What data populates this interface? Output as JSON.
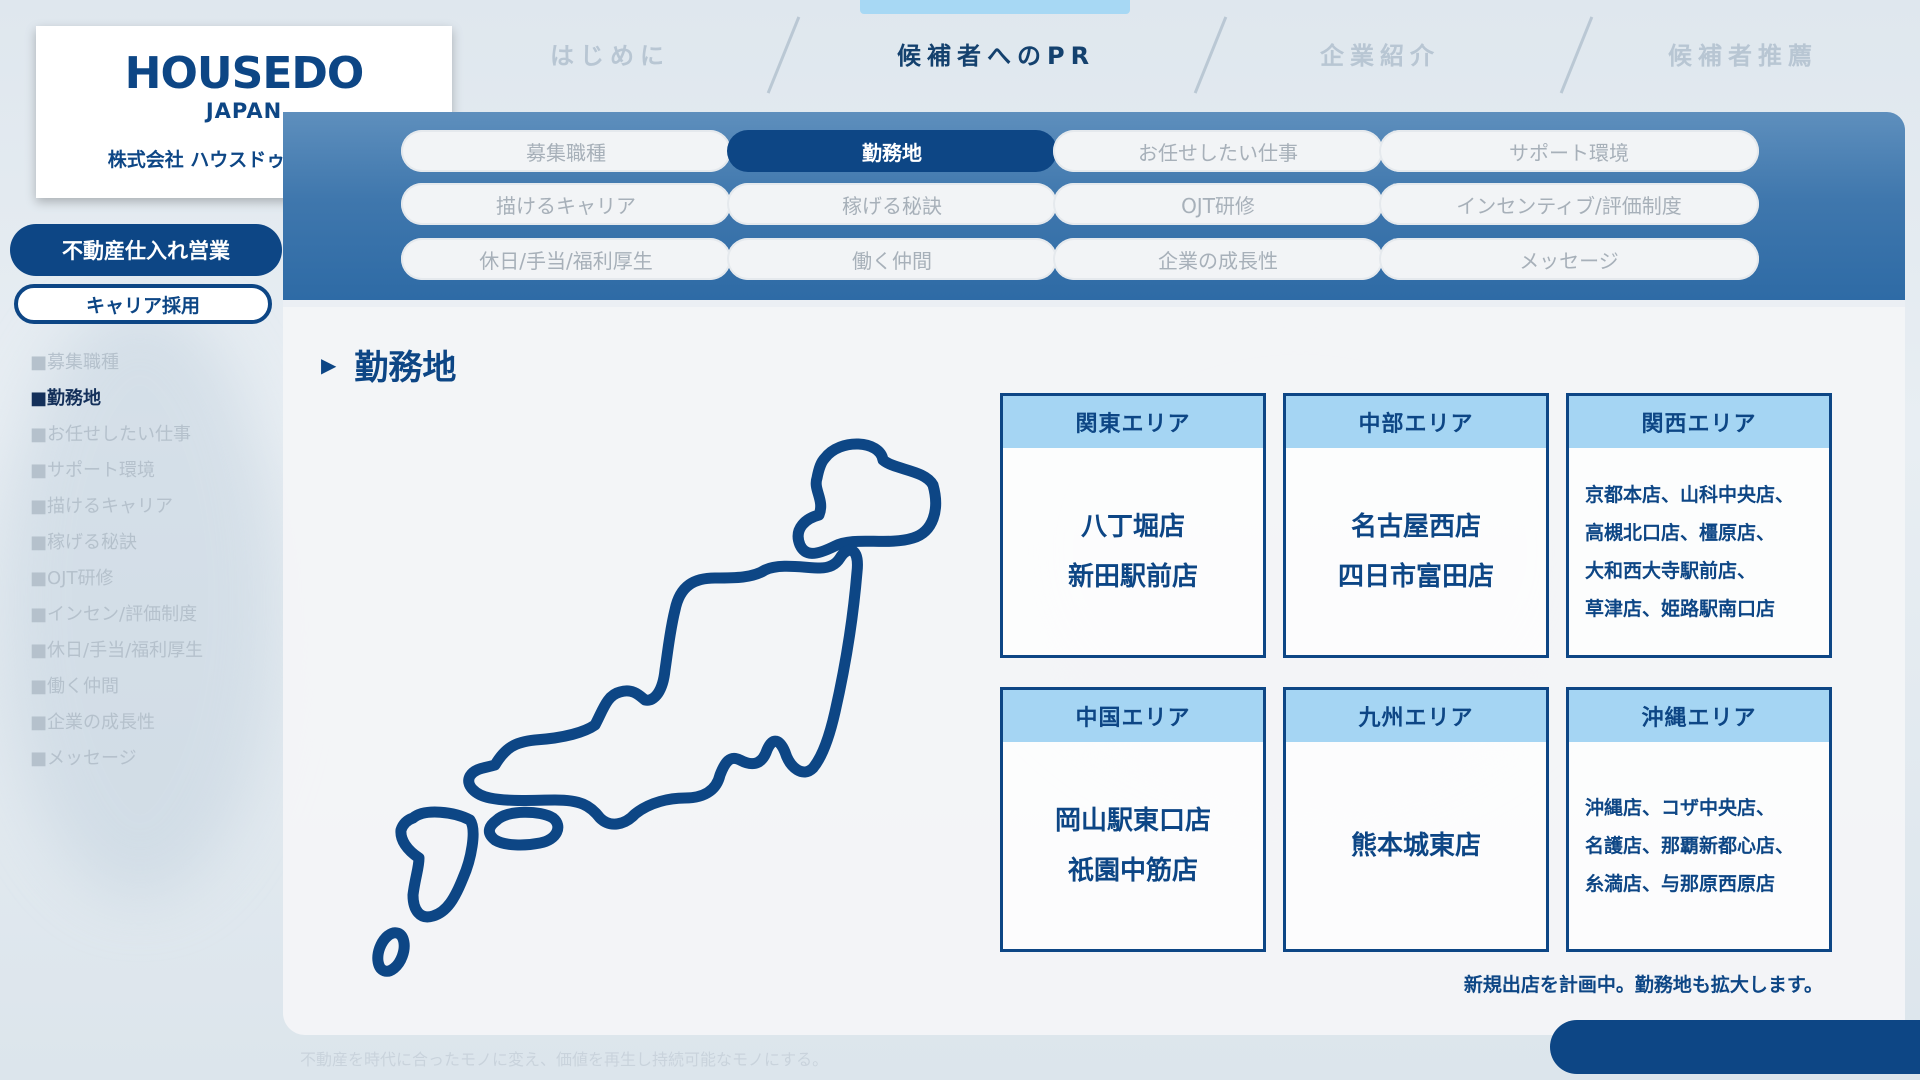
{
  "brand": {
    "logo_main": "HOUSEDO",
    "logo_sub": "JAPAN",
    "company": "株式会社 ハウスドゥ・ジャパン"
  },
  "top_nav": [
    {
      "label": "はじめに",
      "active": false
    },
    {
      "label": "候補者へのPR",
      "active": true
    },
    {
      "label": "企業紹介",
      "active": false
    },
    {
      "label": "候補者推薦",
      "active": false
    }
  ],
  "menu": [
    [
      "募集職種",
      "勤務地",
      "お任せしたい仕事",
      "サポート環境"
    ],
    [
      "描けるキャリア",
      "稼げる秘訣",
      "OJT研修",
      "インセンティブ/評価制度"
    ],
    [
      "休日/手当/福利厚生",
      "働く仲間",
      "企業の成長性",
      "メッセージ"
    ]
  ],
  "menu_active": "勤務地",
  "sidebar": {
    "main_button": "不動産仕入れ営業",
    "sub_button": "キャリア採用",
    "items": [
      "■募集職種",
      "■勤務地",
      "■お任せしたい仕事",
      "■サポート環境",
      "■描けるキャリア",
      "■稼げる秘訣",
      "■OJT研修",
      "■インセン/評価制度",
      "■休日/手当/福利厚生",
      "■働く仲間",
      "■企業の成長性",
      "■メッセージ"
    ],
    "active_index": 1
  },
  "section_title": "勤務地",
  "areas": [
    {
      "name": "関東エリア",
      "stores": [
        "八丁堀店",
        "新田駅前店"
      ]
    },
    {
      "name": "中部エリア",
      "stores": [
        "名古屋西店",
        "四日市富田店"
      ]
    },
    {
      "name": "関西エリア",
      "stores": [
        "京都本店、山科中央店、",
        "高槻北口店、橿原店、",
        "大和西大寺駅前店、",
        "草津店、姫路駅南口店"
      ]
    },
    {
      "name": "中国エリア",
      "stores": [
        "岡山駅東口店",
        "祇園中筋店"
      ]
    },
    {
      "name": "九州エリア",
      "stores": [
        "熊本城東店"
      ]
    },
    {
      "name": "沖縄エリア",
      "stores": [
        "沖縄店、コザ中央店、",
        "名護店、那覇新都心店、",
        "糸満店、与那原西原店"
      ]
    }
  ],
  "note": "新規出店を計画中。勤務地も拡大します。",
  "footer_text": "不動産を時代に合ったモノに変え、価値を再生し持続可能なモノにする。",
  "colors": {
    "primary": "#0d4685",
    "accent": "#a5d5f3"
  }
}
